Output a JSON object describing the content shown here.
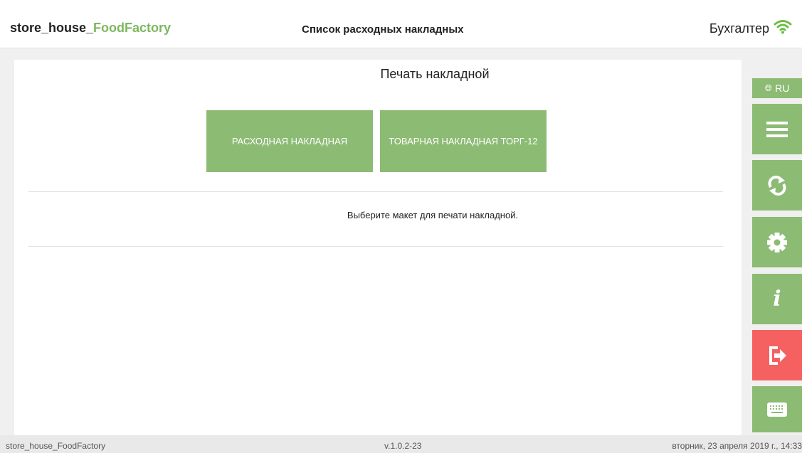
{
  "header": {
    "brand_prefix": "store_house_",
    "brand_accent": "FoodFactory",
    "title": "Список расходных накладных",
    "user": "Бухгалтер",
    "wifi_icon": "wifi-icon"
  },
  "main": {
    "title": "Печать накладной",
    "buttons": [
      {
        "label": "Расходная накладная"
      },
      {
        "label": "Товарная накладная ТОРГ-12"
      }
    ],
    "hint": "Выберите макет для печати накладной."
  },
  "sidebar": {
    "lang_label": "RU",
    "items": [
      {
        "icon": "menu-icon"
      },
      {
        "icon": "sync-icon"
      },
      {
        "icon": "settings-icon"
      },
      {
        "icon": "info-icon",
        "glyph": "i"
      },
      {
        "icon": "exit-icon"
      },
      {
        "icon": "keyboard-icon"
      }
    ]
  },
  "footer": {
    "app_name": "store_house_FoodFactory",
    "version": "v.1.0.2-23",
    "datetime": "вторник, 23 апреля 2019 г., 14:33"
  },
  "colors": {
    "accent": "#8cbb74",
    "brand_green": "#7cb85e",
    "danger": "#f56161"
  }
}
